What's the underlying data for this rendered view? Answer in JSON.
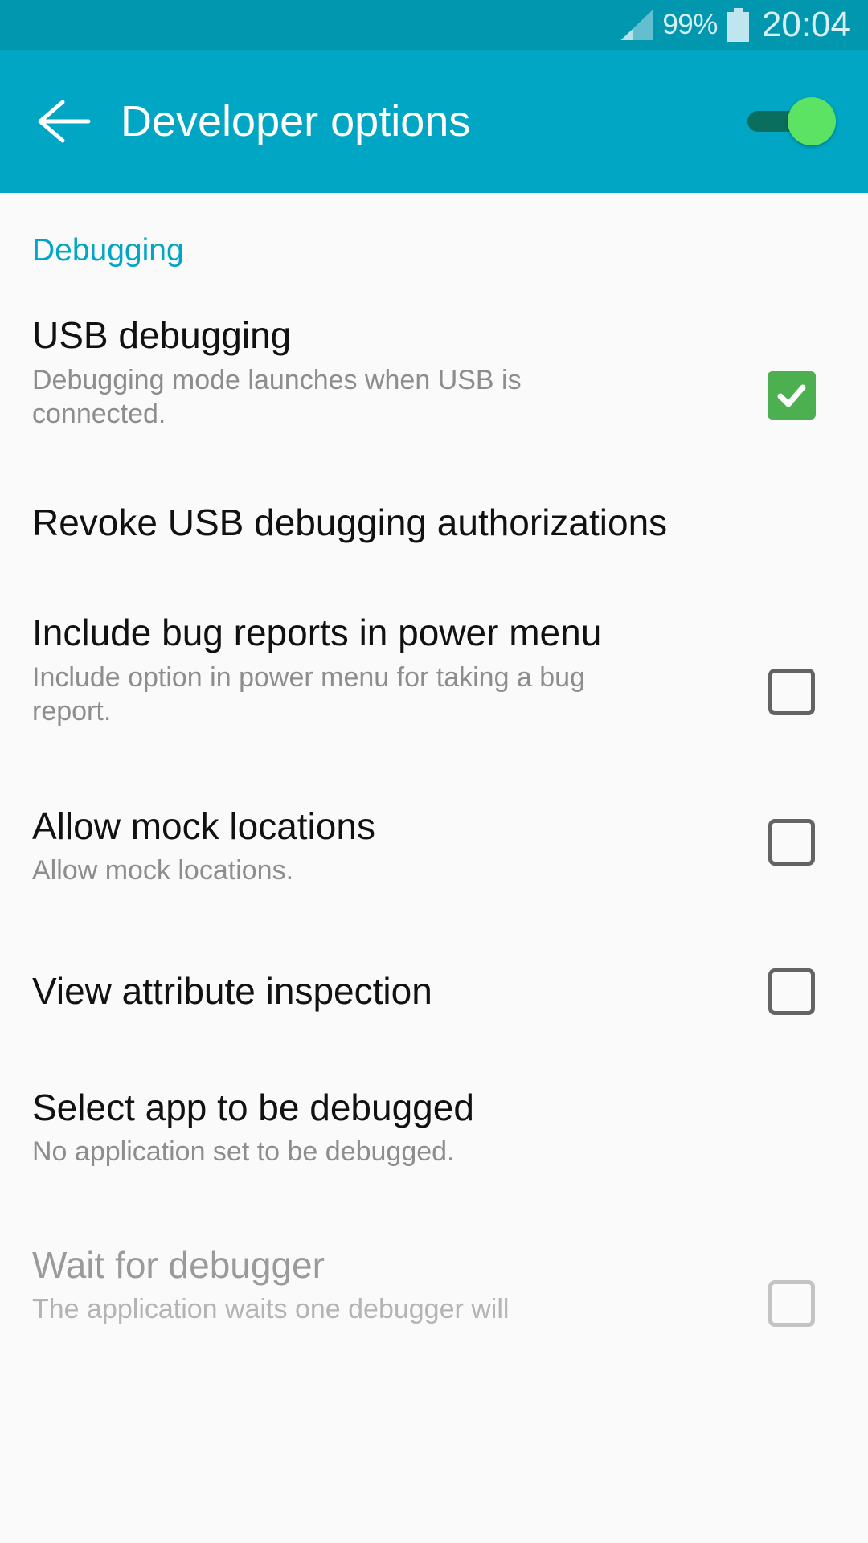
{
  "status_bar": {
    "signal_icon": "signal-bars-icon",
    "battery_percent": "99%",
    "battery_icon": "battery-full-icon",
    "clock": "20:04"
  },
  "app_bar": {
    "back_icon": "back-arrow-icon",
    "title": "Developer options",
    "master_switch": {
      "name": "developer-options-master-switch",
      "state": "on",
      "track_color": "#0a6e5e",
      "knob_color": "#5de364"
    }
  },
  "colors": {
    "status_bar_bg": "#0097af",
    "app_bar_bg": "#00a6c4",
    "accent": "#00a6c4",
    "page_bg": "#fafafa",
    "checked_checkbox": "#4caf50",
    "checkbox_border": "#636363",
    "title_text": "#111111",
    "summary_text": "#8d8d8d",
    "disabled_text": "#9a9a9a"
  },
  "sections": [
    {
      "header": "Debugging",
      "items": [
        {
          "title": "USB debugging",
          "summary": "Debugging mode launches when USB is connected.",
          "widget": "checkbox",
          "checked": true,
          "enabled": true
        },
        {
          "title": "Revoke USB debugging authorizations",
          "summary": "",
          "widget": "none",
          "checked": false,
          "enabled": true
        },
        {
          "title": "Include bug reports in power menu",
          "summary": "Include option in power menu for taking a bug report.",
          "widget": "checkbox",
          "checked": false,
          "enabled": true
        },
        {
          "title": "Allow mock locations",
          "summary": "Allow mock locations.",
          "widget": "checkbox",
          "checked": false,
          "enabled": true
        },
        {
          "title": "View attribute inspection",
          "summary": "",
          "widget": "checkbox",
          "checked": false,
          "enabled": true
        },
        {
          "title": "Select app to be debugged",
          "summary": "No application set to be debugged.",
          "widget": "none",
          "checked": false,
          "enabled": true
        },
        {
          "title": "Wait for debugger",
          "summary": "The application waits one debugger will",
          "widget": "checkbox",
          "checked": false,
          "enabled": false
        }
      ]
    }
  ]
}
